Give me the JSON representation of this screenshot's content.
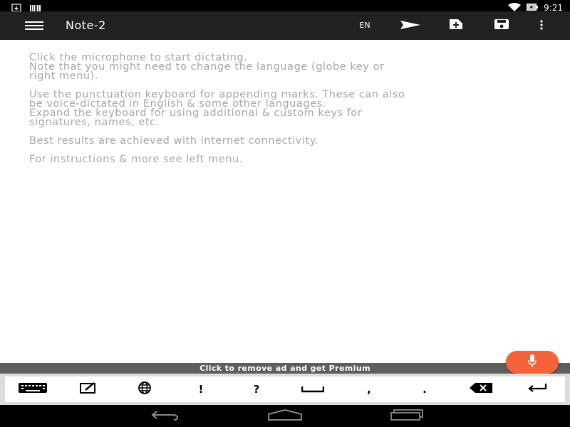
{
  "status_bar": {
    "time": "9:21",
    "left_icons": [
      "download-icon",
      "barcode-icon"
    ],
    "right_icons": [
      "wifi-icon",
      "battery-icon"
    ]
  },
  "app_bar": {
    "title": "Note-2",
    "language": "EN",
    "actions": [
      "send-icon",
      "new-note-icon",
      "save-icon",
      "more-vert-icon"
    ],
    "background": "#212121"
  },
  "content": {
    "paragraphs": [
      "Click the microphone to start dictating.\nNote that you might need to change the language (globe key or\nright menu).",
      "Use the punctuation keyboard for appending marks. These can also\nbe voice-dictated in English & some other languages.\nExpand the keyboard for using additional & custom keys for\nsignatures, names, etc.",
      "Best results are achieved with internet connectivity.",
      "For instructions & more see left menu."
    ],
    "text_color": "#a6a6a6"
  },
  "ad_banner": {
    "text": "Click to remove ad and get Premium"
  },
  "mic_button": {
    "icon": "microphone-icon",
    "color": "#f4623a"
  },
  "keyboard": {
    "keys": [
      {
        "icon": "keyboard-icon"
      },
      {
        "icon": "edit-box-icon"
      },
      {
        "icon": "globe-icon"
      },
      {
        "label": "!"
      },
      {
        "label": "?"
      },
      {
        "icon": "space-icon"
      },
      {
        "label": ","
      },
      {
        "label": "."
      },
      {
        "icon": "backspace-icon"
      },
      {
        "icon": "enter-icon"
      }
    ]
  },
  "nav_bar": {
    "buttons": [
      "back-icon",
      "home-icon",
      "recents-icon"
    ]
  }
}
